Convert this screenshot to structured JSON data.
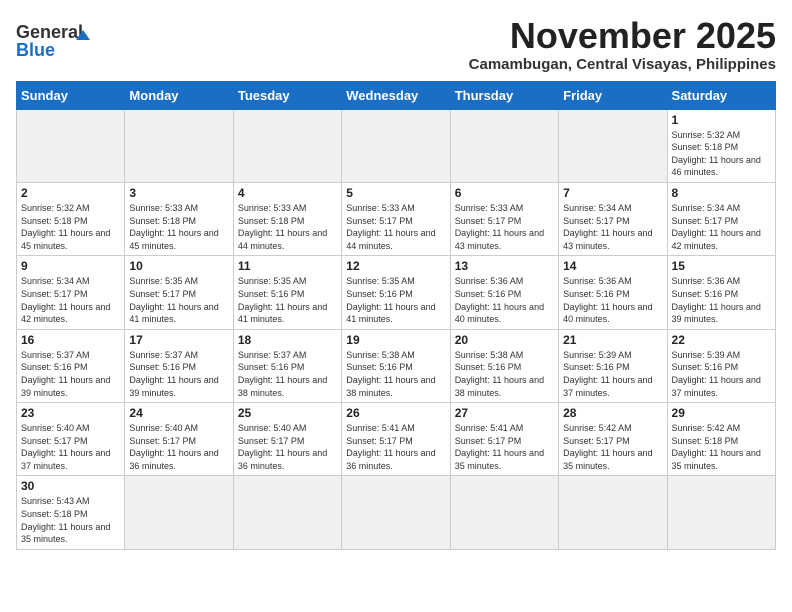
{
  "header": {
    "logo_general": "General",
    "logo_blue": "Blue",
    "month_title": "November 2025",
    "location": "Camambugan, Central Visayas, Philippines"
  },
  "weekdays": [
    "Sunday",
    "Monday",
    "Tuesday",
    "Wednesday",
    "Thursday",
    "Friday",
    "Saturday"
  ],
  "days": [
    {
      "date": 1,
      "sunrise": "5:32 AM",
      "sunset": "5:18 PM",
      "daylight": "11 hours and 46 minutes."
    },
    {
      "date": 2,
      "sunrise": "5:32 AM",
      "sunset": "5:18 PM",
      "daylight": "11 hours and 45 minutes."
    },
    {
      "date": 3,
      "sunrise": "5:33 AM",
      "sunset": "5:18 PM",
      "daylight": "11 hours and 45 minutes."
    },
    {
      "date": 4,
      "sunrise": "5:33 AM",
      "sunset": "5:18 PM",
      "daylight": "11 hours and 44 minutes."
    },
    {
      "date": 5,
      "sunrise": "5:33 AM",
      "sunset": "5:17 PM",
      "daylight": "11 hours and 44 minutes."
    },
    {
      "date": 6,
      "sunrise": "5:33 AM",
      "sunset": "5:17 PM",
      "daylight": "11 hours and 43 minutes."
    },
    {
      "date": 7,
      "sunrise": "5:34 AM",
      "sunset": "5:17 PM",
      "daylight": "11 hours and 43 minutes."
    },
    {
      "date": 8,
      "sunrise": "5:34 AM",
      "sunset": "5:17 PM",
      "daylight": "11 hours and 42 minutes."
    },
    {
      "date": 9,
      "sunrise": "5:34 AM",
      "sunset": "5:17 PM",
      "daylight": "11 hours and 42 minutes."
    },
    {
      "date": 10,
      "sunrise": "5:35 AM",
      "sunset": "5:17 PM",
      "daylight": "11 hours and 41 minutes."
    },
    {
      "date": 11,
      "sunrise": "5:35 AM",
      "sunset": "5:16 PM",
      "daylight": "11 hours and 41 minutes."
    },
    {
      "date": 12,
      "sunrise": "5:35 AM",
      "sunset": "5:16 PM",
      "daylight": "11 hours and 41 minutes."
    },
    {
      "date": 13,
      "sunrise": "5:36 AM",
      "sunset": "5:16 PM",
      "daylight": "11 hours and 40 minutes."
    },
    {
      "date": 14,
      "sunrise": "5:36 AM",
      "sunset": "5:16 PM",
      "daylight": "11 hours and 40 minutes."
    },
    {
      "date": 15,
      "sunrise": "5:36 AM",
      "sunset": "5:16 PM",
      "daylight": "11 hours and 39 minutes."
    },
    {
      "date": 16,
      "sunrise": "5:37 AM",
      "sunset": "5:16 PM",
      "daylight": "11 hours and 39 minutes."
    },
    {
      "date": 17,
      "sunrise": "5:37 AM",
      "sunset": "5:16 PM",
      "daylight": "11 hours and 39 minutes."
    },
    {
      "date": 18,
      "sunrise": "5:37 AM",
      "sunset": "5:16 PM",
      "daylight": "11 hours and 38 minutes."
    },
    {
      "date": 19,
      "sunrise": "5:38 AM",
      "sunset": "5:16 PM",
      "daylight": "11 hours and 38 minutes."
    },
    {
      "date": 20,
      "sunrise": "5:38 AM",
      "sunset": "5:16 PM",
      "daylight": "11 hours and 38 minutes."
    },
    {
      "date": 21,
      "sunrise": "5:39 AM",
      "sunset": "5:16 PM",
      "daylight": "11 hours and 37 minutes."
    },
    {
      "date": 22,
      "sunrise": "5:39 AM",
      "sunset": "5:16 PM",
      "daylight": "11 hours and 37 minutes."
    },
    {
      "date": 23,
      "sunrise": "5:40 AM",
      "sunset": "5:17 PM",
      "daylight": "11 hours and 37 minutes."
    },
    {
      "date": 24,
      "sunrise": "5:40 AM",
      "sunset": "5:17 PM",
      "daylight": "11 hours and 36 minutes."
    },
    {
      "date": 25,
      "sunrise": "5:40 AM",
      "sunset": "5:17 PM",
      "daylight": "11 hours and 36 minutes."
    },
    {
      "date": 26,
      "sunrise": "5:41 AM",
      "sunset": "5:17 PM",
      "daylight": "11 hours and 36 minutes."
    },
    {
      "date": 27,
      "sunrise": "5:41 AM",
      "sunset": "5:17 PM",
      "daylight": "11 hours and 35 minutes."
    },
    {
      "date": 28,
      "sunrise": "5:42 AM",
      "sunset": "5:17 PM",
      "daylight": "11 hours and 35 minutes."
    },
    {
      "date": 29,
      "sunrise": "5:42 AM",
      "sunset": "5:18 PM",
      "daylight": "11 hours and 35 minutes."
    },
    {
      "date": 30,
      "sunrise": "5:43 AM",
      "sunset": "5:18 PM",
      "daylight": "11 hours and 35 minutes."
    }
  ],
  "labels": {
    "sunrise_label": "Sunrise:",
    "sunset_label": "Sunset:",
    "daylight_label": "Daylight:"
  }
}
